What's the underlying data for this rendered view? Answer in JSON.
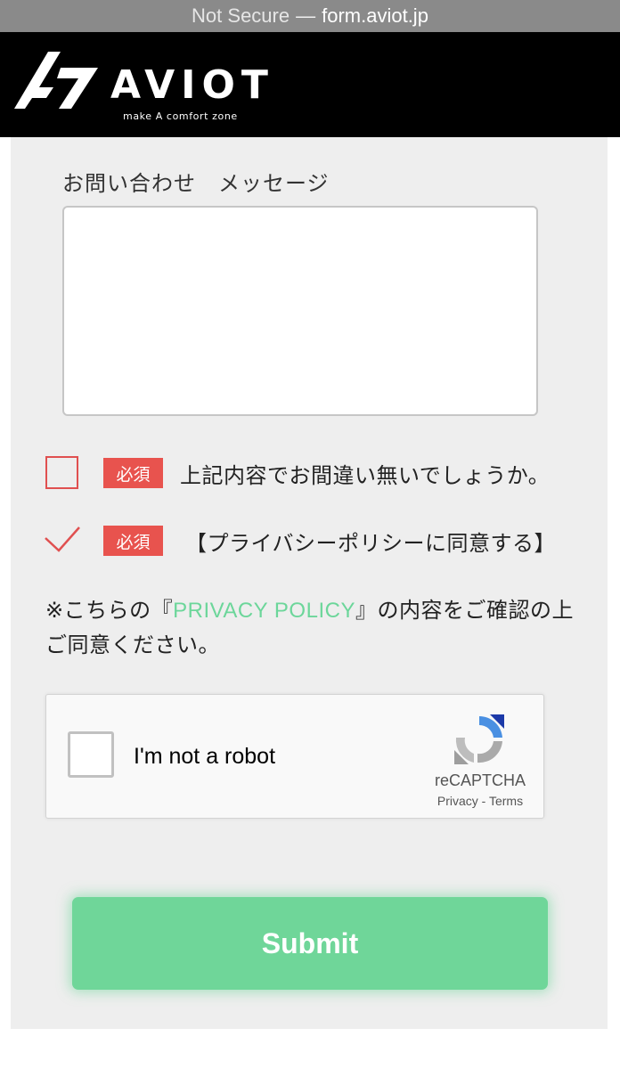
{
  "browser": {
    "security_label": "Not Secure",
    "separator": "—",
    "domain": "form.aviot.jp"
  },
  "header": {
    "logo_text": "AVIOT",
    "tagline": "make A comfort zone",
    "background": "#000000"
  },
  "form": {
    "message_label": "お問い合わせ　メッセージ",
    "message_value": "",
    "confirm": {
      "checked": false,
      "badge": "必須",
      "label": "上記内容でお間違い無いでしょうか。"
    },
    "privacy": {
      "checked": true,
      "badge": "必須",
      "label": "【プライバシーポリシーに同意する】"
    },
    "note": {
      "prefix": "※こちらの『",
      "link_text": "PRIVACY POLICY",
      "suffix": "』の内容をご確認の上ご同意ください。"
    },
    "submit_label": "Submit"
  },
  "recaptcha": {
    "label": "I'm not a robot",
    "brand": "reCAPTCHA",
    "privacy": "Privacy",
    "dash": "-",
    "terms": "Terms",
    "icon": "recaptcha-icon"
  },
  "colors": {
    "accent_green": "#6fd699",
    "required_red": "#e8534e",
    "panel_bg": "#eeeeee"
  }
}
